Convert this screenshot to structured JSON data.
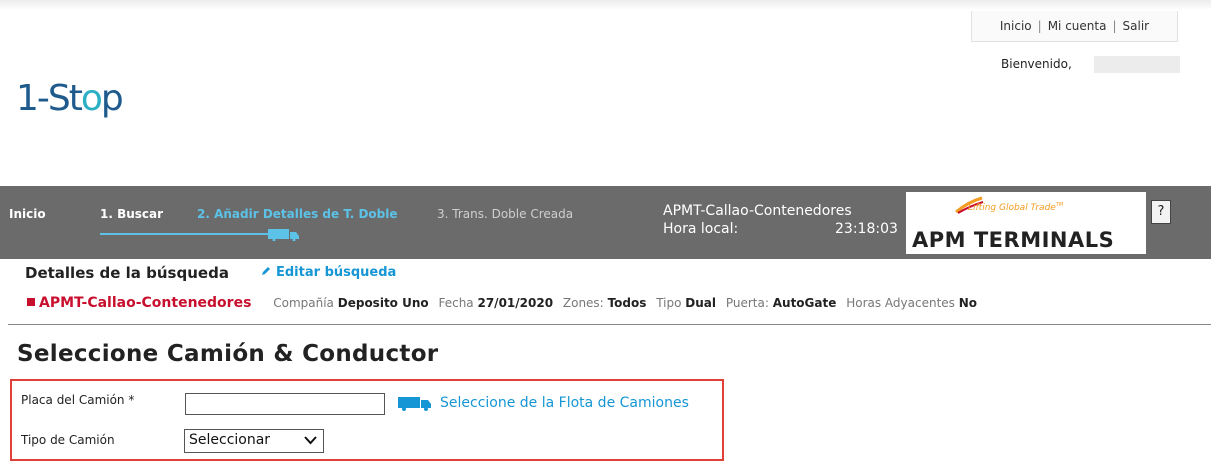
{
  "header": {
    "links": [
      {
        "label": "Inicio"
      },
      {
        "label": "Mi cuenta"
      },
      {
        "label": "Salir"
      }
    ],
    "separator": "|",
    "welcome": "Bienvenido,",
    "logo_pre": "1-St",
    "logo_o": "o",
    "logo_post": "p"
  },
  "navbar": {
    "items": [
      {
        "label": "Inicio"
      },
      {
        "label": "1. Buscar"
      },
      {
        "label": "2. Añadir Detalles de T. Doble"
      },
      {
        "label": "3. Trans. Doble Creada"
      }
    ],
    "terminal": "APMT-Callao-Contenedores",
    "hora_label": "Hora local:",
    "hora_value": "23:18:03",
    "partner_tagline": "Lifting Global Trade",
    "partner_tm": "TM",
    "partner_name": "APM TERMINALS",
    "active_color": "#5cc2e7"
  },
  "search": {
    "heading": "Detalles de la búsqueda",
    "edit_label": "Editar búsqueda",
    "terminal": "APMT-Callao-Contenedores",
    "fields": [
      {
        "label": "Compañía",
        "value": "Deposito Uno"
      },
      {
        "label": "Fecha",
        "value": "27/01/2020"
      },
      {
        "label": "Zones:",
        "value": "Todos"
      },
      {
        "label": "Tipo",
        "value": "Dual"
      },
      {
        "label": "Puerta:",
        "value": "AutoGate"
      },
      {
        "label": "Horas Adyacentes",
        "value": "No"
      }
    ]
  },
  "form": {
    "title": "Seleccione Camión & Conductor",
    "plate_label": "Placa del Camión *",
    "plate_value": "",
    "fleet_link": "Seleccione de la Flota de Camiones",
    "type_label": "Tipo de Camión",
    "type_selected": "Seleccionar",
    "highlight_color": "#e0403a"
  }
}
